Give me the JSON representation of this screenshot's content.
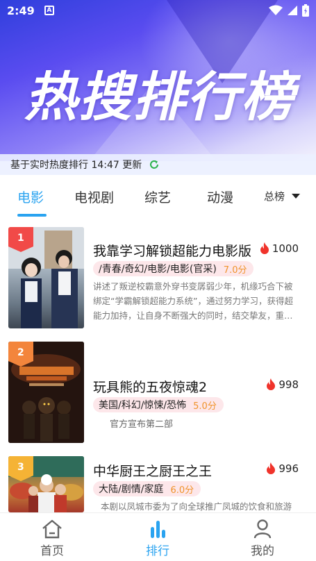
{
  "status_bar": {
    "time": "2:49",
    "notification_letter": "A"
  },
  "hero": {
    "title": "热搜排行榜"
  },
  "update_bar": {
    "text": "基于实时热度排行 14:47 更新"
  },
  "tabs": [
    {
      "label": "电影",
      "active": true
    },
    {
      "label": "电视剧",
      "active": false
    },
    {
      "label": "综艺",
      "active": false
    },
    {
      "label": "动漫",
      "active": false
    }
  ],
  "range_select": {
    "value": "总榜"
  },
  "items": [
    {
      "rank": "1",
      "title": "我靠学习解锁超能力电影版",
      "heat": "1000",
      "tags": "/青春/奇幻/电影/电影(官采)",
      "score": "7.0分",
      "desc": "讲述了叛逆校霸意外穿书变孱弱少年，机缘巧合下被绑定“学霸解锁超能力系统”，通过努力学习，获得超能力加持，让自身不断强大的同时，结交挚友，重…",
      "badge_color": "#f14a48"
    },
    {
      "rank": "2",
      "title": "玩具熊的五夜惊魂2",
      "heat": "998",
      "tags": "美国/科幻/惊悚/恐怖",
      "score": "5.0分",
      "note": "官方宣布第二部",
      "badge_color": "#f3853c"
    },
    {
      "rank": "3",
      "title": "中华厨王之厨王之王",
      "heat": "996",
      "tags": "大陆/剧情/家庭",
      "score": "6.0分",
      "desc": "本剧以凤城市委为了向全球推广凤城的饮食和旅游",
      "badge_color": "#f5b335"
    }
  ],
  "bottom_nav": [
    {
      "label": "首页",
      "icon": "home-icon",
      "active": false
    },
    {
      "label": "排行",
      "icon": "ranking-icon",
      "active": true
    },
    {
      "label": "我的",
      "icon": "profile-icon",
      "active": false
    }
  ],
  "colors": {
    "accent": "#2aa3f0",
    "heat": "#f0332b",
    "score": "#f0932b",
    "tag_bg": "#fde7ea"
  }
}
